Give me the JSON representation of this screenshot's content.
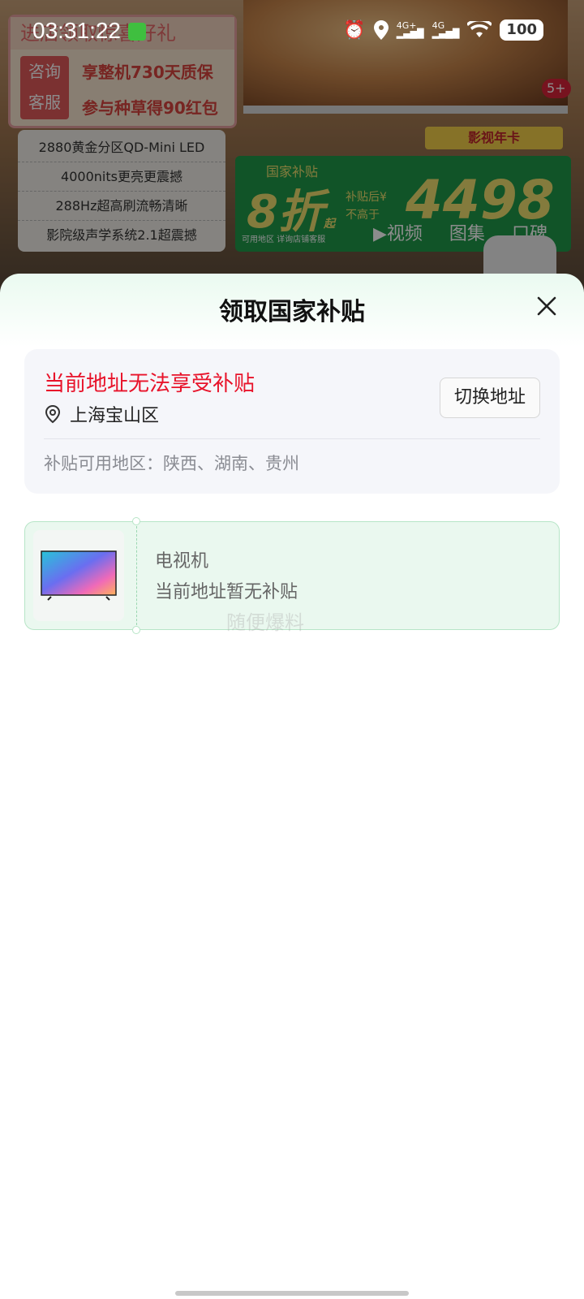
{
  "status_bar": {
    "time": "03:31:22",
    "network_1": "4G+",
    "network_2": "4G",
    "battery": "100",
    "icons": [
      "alarm-icon",
      "location-icon",
      "signal-icon",
      "signal-icon",
      "wifi-icon",
      "battery-icon"
    ]
  },
  "background_page": {
    "banner_title": "进店领取惊喜好礼",
    "banner_badge": "咨询 客服",
    "banner_promos": [
      "享整机730天质保",
      "参与种草得90红包"
    ],
    "features": [
      "2880黄金分区QD-Mini LED",
      "4000nits更亮更震撼",
      "288Hz超高刷流畅清晰",
      "影院级声学系统2.1超震撼"
    ],
    "subsidy": {
      "label": "国家补贴",
      "discount": "8折",
      "discount_suffix": "起",
      "note_line1": "补贴后¥",
      "note_line2": "不高于",
      "price": "4498",
      "footnote": "可用地区 详询店铺客服"
    },
    "year_card": "影视年卡",
    "media_tabs": [
      "▶视频",
      "图集",
      "口碑"
    ],
    "image_count": "5+"
  },
  "sheet": {
    "title": "领取国家补贴",
    "address_card": {
      "warning": "当前地址无法享受补贴",
      "address": "上海宝山区",
      "switch_button": "切换地址",
      "region_label": "补贴可用地区：",
      "regions": "陕西、湖南、贵州"
    },
    "product": {
      "name": "电视机",
      "status": "当前地址暂无补贴"
    },
    "watermark": "随便爆料"
  },
  "colors": {
    "warning_red": "#e8132a",
    "sheet_green_tint": "#eafaf0",
    "product_card_bg": "#eaf8ef"
  }
}
